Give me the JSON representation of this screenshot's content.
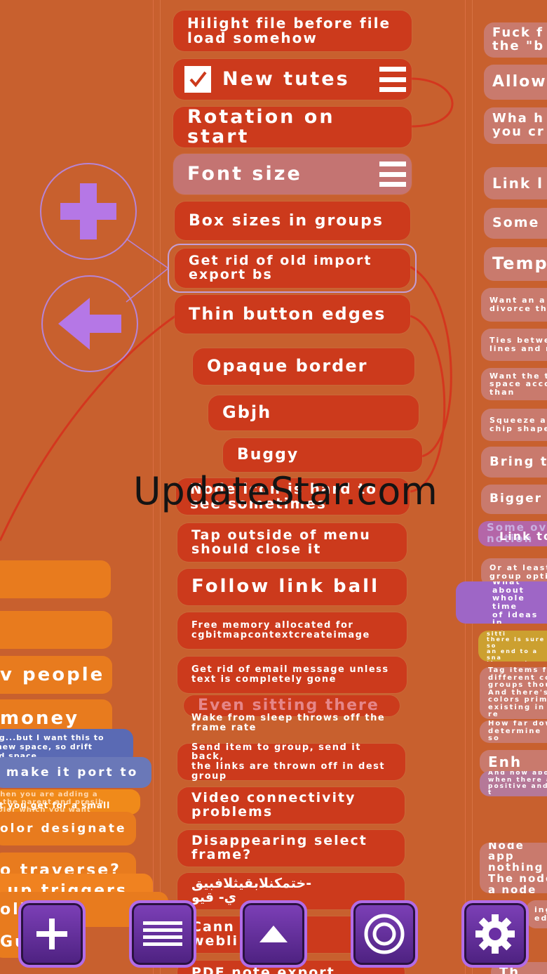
{
  "center_notes": [
    {
      "text": "Hilight file before file\nload somehow"
    },
    {
      "text": "New tutes"
    },
    {
      "text": "Rotation on start"
    },
    {
      "text": "Font size"
    },
    {
      "text": "Box sizes in groups"
    },
    {
      "text": "Get rid of old import\nexport bs"
    },
    {
      "text": "Thin button edges"
    },
    {
      "text": "Opaque border"
    },
    {
      "text": "Gbjh"
    },
    {
      "text": "Buggy"
    },
    {
      "text": "Node icon is hard to\nsee sometimes"
    },
    {
      "text": "Tap outside of menu\nshould close it"
    },
    {
      "text": "Follow link ball"
    },
    {
      "text": "Free memory allocated for\ncgbitmapcontextcreateimage"
    },
    {
      "text": "Get rid of email message unless\ntext is completely gone"
    },
    {
      "text": "Even sitting there"
    },
    {
      "text": "Wake from sleep throws off the\nframe rate"
    },
    {
      "text": "Send item to group, send it back,\nthe links are thrown off in dest\ngroup"
    },
    {
      "text": "Video connectivity\nproblems"
    },
    {
      "text": "Disappearing select\nframe?"
    },
    {
      "text": "ختمكنلابقيثلافبيق-\nي- قيو"
    },
    {
      "text": "Cann          t w\nwebli"
    },
    {
      "text": "PDF note export pages"
    }
  ],
  "right_notes": [
    {
      "text": "Fuck f\nthe \"b"
    },
    {
      "text": "Allow"
    },
    {
      "text": "Wha h\nyou cr"
    },
    {
      "text": "Link l"
    },
    {
      "text": "Some"
    },
    {
      "text": "Temp"
    },
    {
      "text": "Want an a\ndivorce th"
    },
    {
      "text": "Ties betwe\nlines and n"
    },
    {
      "text": "Want the t\nspace acco\nthan"
    },
    {
      "text": "Squeeze al\nchip shape"
    },
    {
      "text": "Bring t"
    },
    {
      "text": "Bigger"
    },
    {
      "text": "Some ov\nnotion"
    },
    {
      "text": "Link to"
    },
    {
      "text": "Or at least\ngroup optio"
    },
    {
      "text": "What about\nwhole time\nof ideas in"
    },
    {
      "text": "So you are sitti\nthere is sure so\nan end to a sna\nthere not"
    },
    {
      "text": "Tag items fo\ndifferent col\ngroups thou\nAnd there's\ncolors prima\nexisting in re"
    },
    {
      "text": "How far dow\ndetermine so"
    },
    {
      "text": "Enh"
    },
    {
      "text": "And how abo\nwhen there a\npositive and t"
    },
    {
      "text": "Node app\nnothing\nThe node\na node"
    },
    {
      "text": "ing\ned."
    },
    {
      "text": "Th"
    }
  ],
  "left_notes": [
    {
      "text": ""
    },
    {
      "text": ""
    },
    {
      "text": "v people"
    },
    {
      "text": "money"
    },
    {
      "text": "ng...but I want this to\n new space, so drift\ned space"
    },
    {
      "text": " make it port to"
    },
    {
      "text": "when you are adding a\nif the parent and presib\ncolor which you want"
    },
    {
      "text": "at you get for a small\nw names"
    },
    {
      "text": "olor designate"
    },
    {
      "text": "o traverse?"
    },
    {
      "text": " up triggers"
    },
    {
      "text": "oli"
    },
    {
      "text": "Gu"
    }
  ],
  "toolbar": {
    "add": "add-icon",
    "menu": "menu-icon",
    "up": "up-arrow-icon",
    "target": "target-icon",
    "settings": "gear-icon"
  },
  "side_controls": {
    "plus": "plus-icon",
    "back": "back-arrow-icon"
  },
  "watermark": "UpdateStar.com",
  "colors": {
    "background": "#c8602e",
    "note": "#cc3a1c",
    "note_selected": "#c47472",
    "toolbar": "#6a2fa3",
    "accent_purple": "#b684d6"
  }
}
